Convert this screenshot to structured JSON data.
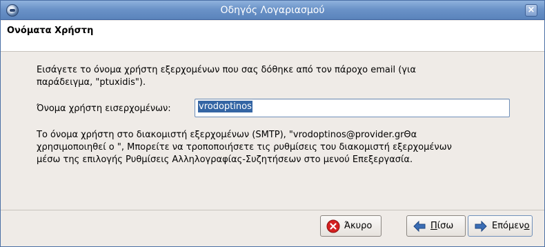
{
  "window": {
    "title": "Οδηγός Λογαριασμού"
  },
  "header": {
    "page_title": "Ονόματα Χρήστη"
  },
  "content": {
    "intro_line1": "Εισάγετε το όνομα χρήστη εξερχομένων που σας δόθηκε από τον πάροχο email (για",
    "intro_line2": "παράδειγμα, \"ptuxidis\").",
    "field_label": "Όνομα χρήστη εισερχομένων:",
    "field_value": "vrodoptinos",
    "info_line1": "Το όνομα χρήστη στο διακομιστή εξερχομένων (SMTP), \"vrodoptinos@provider.grΘα",
    "info_line2": "χρησιμοποιηθεί ο \", Μπορείτε να τροποποιήσετε τις ρυθμίσεις του διακομιστή εξερχομένων",
    "info_line3": "μέσω της επιλογής Ρυθμίσεις Αλληλογραφίας-Συζητήσεων στο μενού Επεξεργασία."
  },
  "buttons": {
    "cancel_label": "Άκυρο",
    "back_label_prefix": "",
    "back_label_mnemonic": "Π",
    "back_label_rest": "ίσω",
    "next_label_prefix": "Επόμεν",
    "next_label_mnemonic": "ο",
    "next_label_rest": ""
  },
  "colors": {
    "titlebar": "#6b93c8",
    "selection": "#3465a4",
    "cancel_icon": "#d42020",
    "arrow_icon": "#3a6db5"
  },
  "icons": {
    "app": "thunderbird-icon",
    "close": "close-icon",
    "cancel": "cancel-icon",
    "back": "arrow-left-icon",
    "next": "arrow-right-icon"
  }
}
